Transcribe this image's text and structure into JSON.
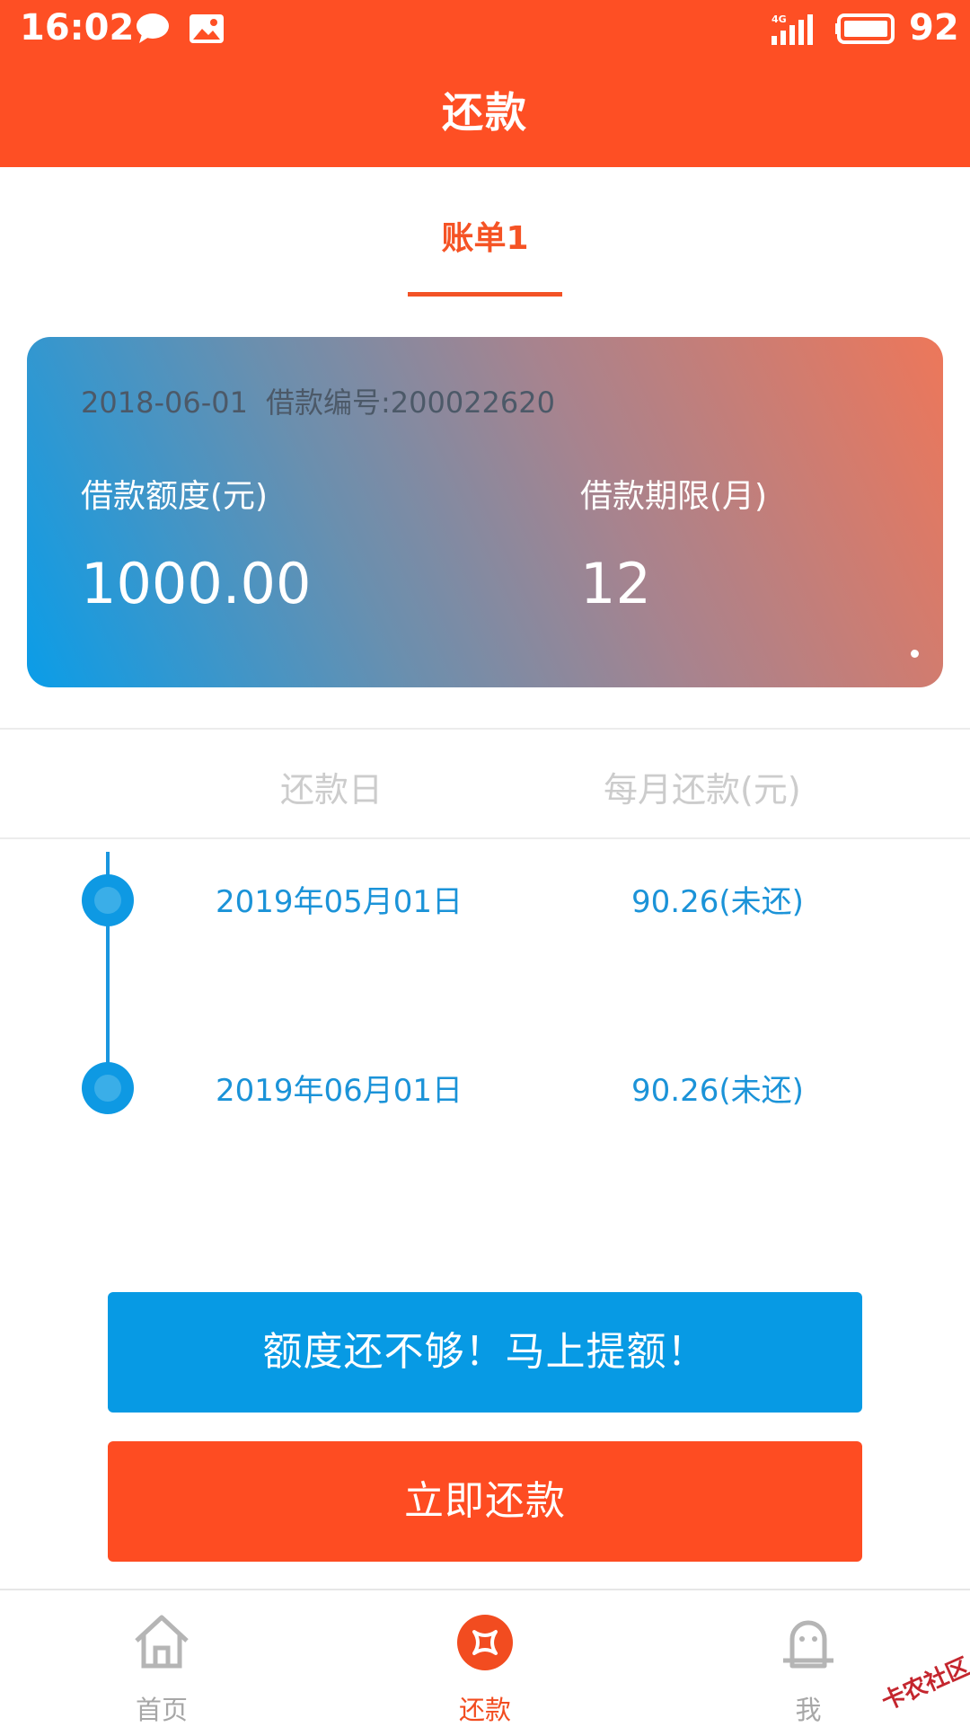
{
  "status_bar": {
    "time": "16:02",
    "network": "4G",
    "battery": "92"
  },
  "header": {
    "title": "还款"
  },
  "tabs": [
    {
      "label": "账单1",
      "active": true
    }
  ],
  "loan_card": {
    "date": "2018-06-01",
    "loan_number": "借款编号:200022620",
    "amount_label": "借款额度(元)",
    "amount_value": "1000.00",
    "term_label": "借款期限(月)",
    "term_value": "12"
  },
  "schedule": {
    "headers": {
      "date": "还款日",
      "amount": "每月还款(元)"
    },
    "rows": [
      {
        "date": "2019年05月01日",
        "amount": "90.26(未还)"
      },
      {
        "date": "2019年06月01日",
        "amount": "90.26(未还)"
      }
    ]
  },
  "buttons": {
    "raise_limit": "额度还不够！马上提额！",
    "repay_now": "立即还款"
  },
  "bottom_nav": [
    {
      "label": "首页",
      "icon": "home-icon",
      "active": false
    },
    {
      "label": "还款",
      "icon": "repay-icon",
      "active": true
    },
    {
      "label": "我",
      "icon": "profile-icon",
      "active": false
    }
  ],
  "watermark": "卡农社区",
  "colors": {
    "brand_orange": "#fe4f24",
    "accent_blue": "#079ae4",
    "timeline_blue": "#1b93d8"
  }
}
